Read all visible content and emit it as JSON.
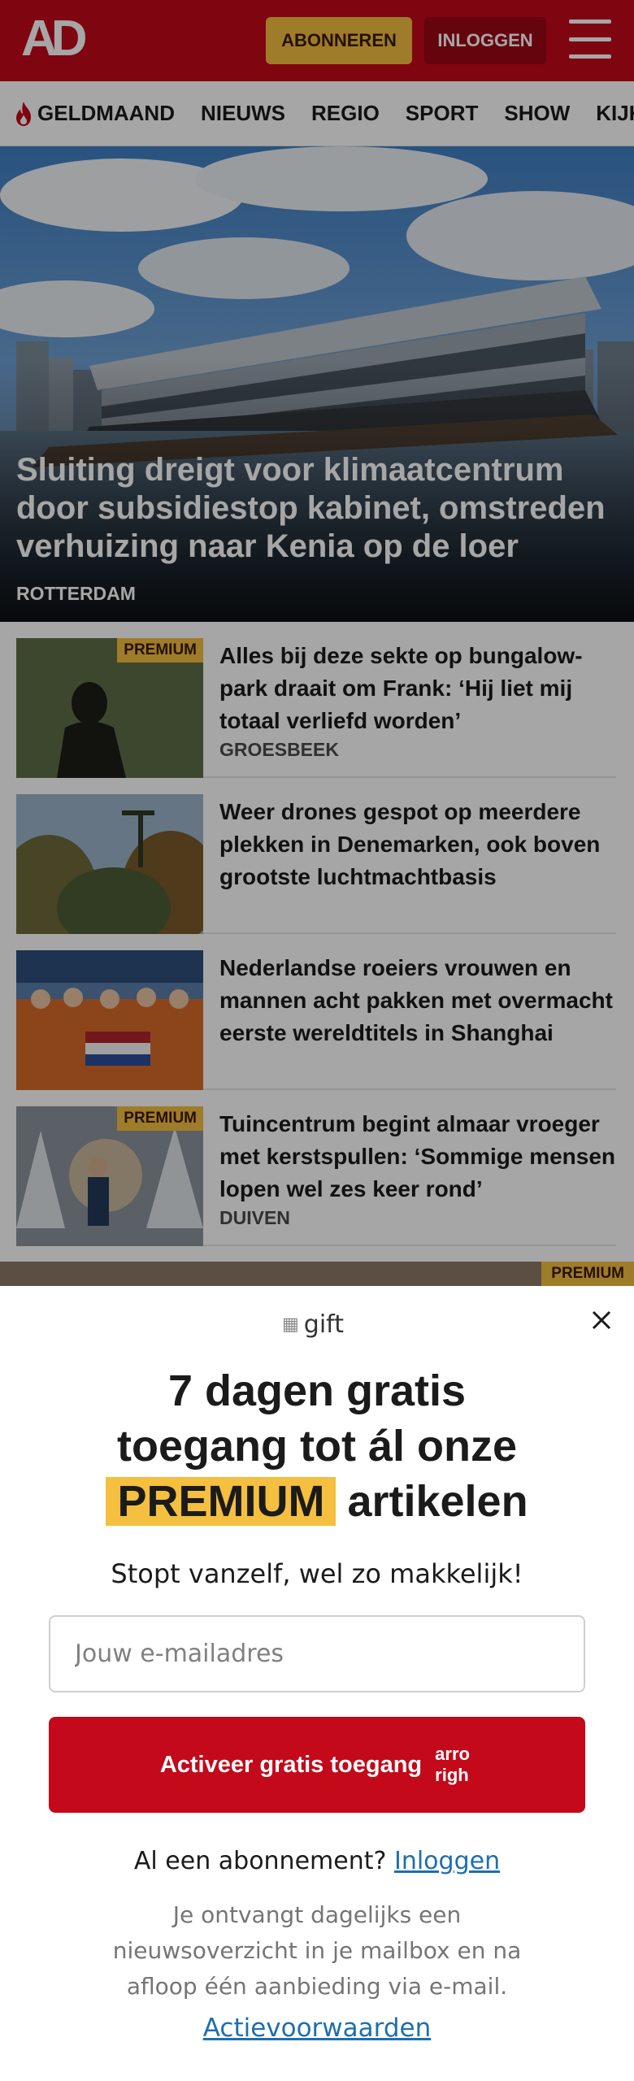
{
  "header": {
    "logo": "AD",
    "subscribe_label": "ABONNEREN",
    "login_label": "INLOGGEN",
    "menu_icon": "hamburger-icon",
    "background_color": "#c3091a"
  },
  "nav": {
    "items": [
      {
        "label": "GELDMAAND",
        "icon": "flame-icon"
      },
      {
        "label": "NIEUWS"
      },
      {
        "label": "REGIO"
      },
      {
        "label": "SPORT"
      },
      {
        "label": "SHOW"
      },
      {
        "label": "KIJK"
      }
    ]
  },
  "hero": {
    "title": "Sluiting dreigt voor klimaatcentrum door subsidiestop kabinet, omstreden verhuizing naar Kenia op de loer",
    "location": "ROTTERDAM"
  },
  "articles": [
    {
      "title": "Alles bij deze sekte op bungalow­park draait om Frank: ‘Hij liet mij totaal verliefd worden’",
      "location": "GROESBEEK",
      "badge": "PREMIUM"
    },
    {
      "title": "Weer drones gespot op meerdere plekken in Denemarken, ook boven grootste luchtmachtbasis",
      "location": "",
      "badge": ""
    },
    {
      "title": "Nederlandse roeiers vrouwen en mannen acht pakken met overmacht eerste wereldtitels in Shanghai",
      "location": "",
      "badge": ""
    },
    {
      "title": "Tuincentrum begint almaar vroeger met kerstspullen: ‘Sommige mensen lopen wel zes keer rond’",
      "location": "DUIVEN",
      "badge": "PREMIUM"
    }
  ],
  "strip_badge": "PREMIUM",
  "modal": {
    "gift_alt": "gift",
    "title_line1": "7 dagen gratis",
    "title_line2": "toegang tot ál onze",
    "title_premium": "PREMIUM",
    "title_rest": "artikelen",
    "subtitle": "Stopt vanzelf, wel zo makkelijk!",
    "email_placeholder": "Jouw e-mailadres",
    "activate_label": "Activeer gratis toegang",
    "arrow_alt_line1": "arro",
    "arrow_alt_line2": "righ",
    "have_subscription": "Al een abonnement?",
    "login_link": "Inloggen",
    "info": "Je ontvangt dagelijks een nieuwsoverzicht in je mailbox en na afloop één aanbieding via e-mail.",
    "terms_link": "Actievoorwaarden",
    "accent_color": "#c3091a",
    "premium_color": "#f5bf3f",
    "link_color": "#1e6fad"
  }
}
